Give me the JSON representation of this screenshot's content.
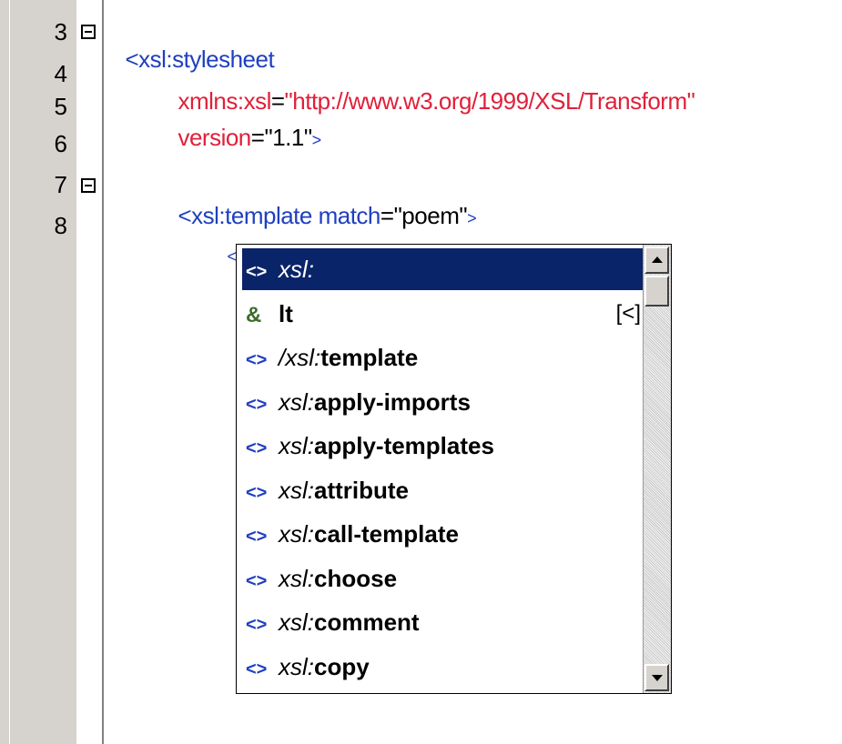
{
  "editor": {
    "line_numbers": [
      "3",
      "4",
      "5",
      "6",
      "7",
      "8"
    ],
    "lines": {
      "l3_tag": "<xsl:stylesheet",
      "l4_attr": "xmlns:xsl",
      "l4_eq": "=",
      "l4_val": "\"http://www.w3.org/1999/XSL/Transform\"",
      "l5_attr": "version",
      "l5_eq": "=",
      "l5_val": "\"1.1\"",
      "l5_close": ">",
      "l7_tag": "<xsl:template",
      "l7_attr": " match",
      "l7_eq": "=",
      "l7_val": "\"poem\"",
      "l7_close": ">",
      "l8_cursor": "<"
    }
  },
  "completion": {
    "items": [
      {
        "icon": "element-icon",
        "glyph": "<>",
        "prefix": "xsl:",
        "name": "",
        "hint": "",
        "selected": true
      },
      {
        "icon": "entity-icon",
        "glyph": "&",
        "prefix": "",
        "name": "lt",
        "hint": "[<]",
        "selected": false
      },
      {
        "icon": "element-icon",
        "glyph": "<>",
        "prefix": "/xsl:",
        "name": "template",
        "hint": "",
        "selected": false
      },
      {
        "icon": "element-icon",
        "glyph": "<>",
        "prefix": "xsl:",
        "name": "apply-imports",
        "hint": "",
        "selected": false
      },
      {
        "icon": "element-icon",
        "glyph": "<>",
        "prefix": "xsl:",
        "name": "apply-templates",
        "hint": "",
        "selected": false
      },
      {
        "icon": "element-icon",
        "glyph": "<>",
        "prefix": "xsl:",
        "name": "attribute",
        "hint": "",
        "selected": false
      },
      {
        "icon": "element-icon",
        "glyph": "<>",
        "prefix": "xsl:",
        "name": "call-template",
        "hint": "",
        "selected": false
      },
      {
        "icon": "element-icon",
        "glyph": "<>",
        "prefix": "xsl:",
        "name": "choose",
        "hint": "",
        "selected": false
      },
      {
        "icon": "element-icon",
        "glyph": "<>",
        "prefix": "xsl:",
        "name": "comment",
        "hint": "",
        "selected": false
      },
      {
        "icon": "element-icon",
        "glyph": "<>",
        "prefix": "xsl:",
        "name": "copy",
        "hint": "",
        "selected": false
      }
    ]
  },
  "colors": {
    "tag": "#1f3fbf",
    "attribute": "#e0203a",
    "selection": "#0a246a"
  }
}
